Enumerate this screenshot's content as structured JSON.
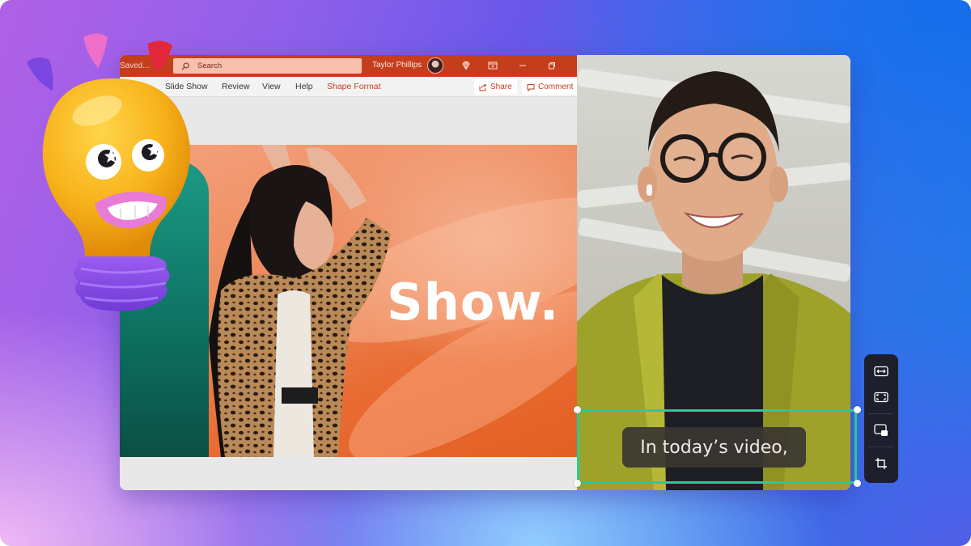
{
  "app": {
    "save_status": "Saved...",
    "search_placeholder": "Search",
    "user_name": "Taylor Phillips",
    "titlebar_icons": [
      "diamond-icon",
      "present-icon",
      "minimize-icon",
      "restore-icon"
    ]
  },
  "ribbon": {
    "tabs": [
      {
        "label": "Slide Show"
      },
      {
        "label": "Review"
      },
      {
        "label": "View"
      },
      {
        "label": "Help"
      },
      {
        "label": "Shape Format",
        "active": true
      }
    ],
    "share_label": "Share",
    "comment_label": "Comment"
  },
  "slide": {
    "title": "Show."
  },
  "video": {
    "caption": "In today’s video,"
  },
  "toolbar": {
    "tools": [
      "fit-width-icon",
      "fullscreen-icon",
      "picture-in-picture-icon",
      "crop-icon"
    ]
  },
  "colors": {
    "brand": "#c43e1c",
    "selection": "#27cc93",
    "toolbar_bg": "#1e1f2c"
  }
}
